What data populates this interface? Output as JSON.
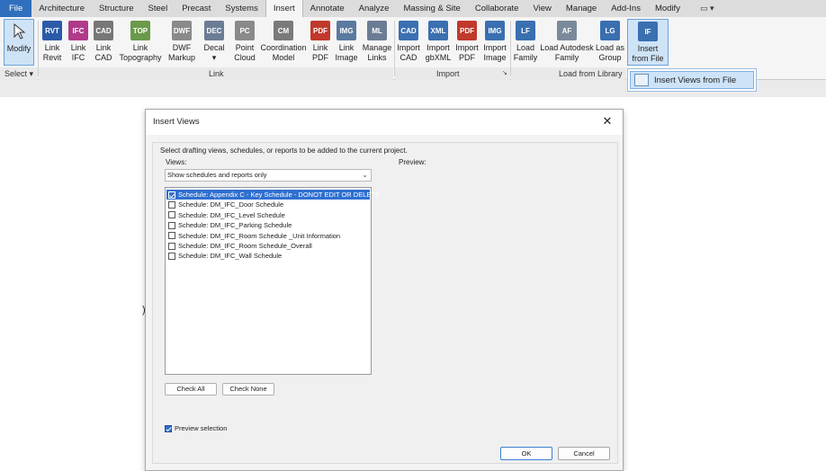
{
  "tabs": {
    "file": "File",
    "items": [
      "Architecture",
      "Structure",
      "Steel",
      "Precast",
      "Systems",
      "Insert",
      "Annotate",
      "Analyze",
      "Massing & Site",
      "Collaborate",
      "View",
      "Manage",
      "Add-Ins",
      "Modify"
    ],
    "active": "Insert",
    "extra": "▭ ▾"
  },
  "ribbon": {
    "modify": {
      "l1": "Modify",
      "l2": ""
    },
    "select": "Select ▾",
    "link_buttons": [
      {
        "l1": "Link",
        "l2": "Revit",
        "icon": "RVT",
        "color": "#2b5aa8"
      },
      {
        "l1": "Link",
        "l2": "IFC",
        "icon": "IFC",
        "color": "#b03a8a"
      },
      {
        "l1": "Link",
        "l2": "CAD",
        "icon": "CAD",
        "color": "#777777"
      },
      {
        "l1": "Link",
        "l2": "Topography",
        "icon": "TOP",
        "color": "#6a9a4a"
      },
      {
        "l1": "DWF",
        "l2": "Markup",
        "icon": "DWF",
        "color": "#8a8a8a"
      },
      {
        "l1": "Decal",
        "l2": "▾",
        "icon": "DEC",
        "color": "#6b7d95"
      },
      {
        "l1": "Point",
        "l2": "Cloud",
        "icon": "PC",
        "color": "#8a8a8a"
      },
      {
        "l1": "Coordination",
        "l2": "Model",
        "icon": "CM",
        "color": "#7a7a7a"
      },
      {
        "l1": "Link",
        "l2": "PDF",
        "icon": "PDF",
        "color": "#c0392b"
      },
      {
        "l1": "Link",
        "l2": "Image",
        "icon": "IMG",
        "color": "#5a7aa0"
      },
      {
        "l1": "Manage",
        "l2": "Links",
        "icon": "ML",
        "color": "#6b7d95"
      }
    ],
    "import_buttons": [
      {
        "l1": "Import",
        "l2": "CAD",
        "icon": "CAD",
        "color": "#3a6fb0"
      },
      {
        "l1": "Import",
        "l2": "gbXML",
        "icon": "XML",
        "color": "#3a6fb0"
      },
      {
        "l1": "Import",
        "l2": "PDF",
        "icon": "PDF",
        "color": "#c0392b"
      },
      {
        "l1": "Import",
        "l2": "Image",
        "icon": "IMG",
        "color": "#3a6fb0"
      }
    ],
    "library_buttons": [
      {
        "l1": "Load",
        "l2": "Family",
        "icon": "LF",
        "color": "#3a6fb0"
      },
      {
        "l1": "Load Autodesk",
        "l2": "Family",
        "icon": "AF",
        "color": "#7a8a9a"
      },
      {
        "l1": "Load as",
        "l2": "Group",
        "icon": "LG",
        "color": "#3a6fb0"
      },
      {
        "l1": "Insert",
        "l2": "from File",
        "icon": "IF",
        "color": "#3a6fb0"
      }
    ],
    "panels": {
      "link": "Link",
      "import": "Import",
      "library": "Load from Library",
      "import_arrow": "↘"
    }
  },
  "dropdown": {
    "item": "Insert Views from File"
  },
  "dialog": {
    "title": "Insert Views",
    "close": "✕",
    "instruction": "Select drafting views, schedules, or reports to be added to the current project.",
    "views_label": "Views:",
    "preview_label": "Preview:",
    "filter_value": "Show schedules and reports only",
    "filter_chevron": "⌄",
    "items": [
      {
        "label": "Schedule: Appendix C - Key Schedule - DONOT EDIT OR DELETE",
        "checked": true,
        "selected": true
      },
      {
        "label": "Schedule: DM_IFC_Door Schedule",
        "checked": false,
        "selected": false
      },
      {
        "label": "Schedule: DM_IFC_Level Schedule",
        "checked": false,
        "selected": false
      },
      {
        "label": "Schedule: DM_IFC_Parking Schedule",
        "checked": false,
        "selected": false
      },
      {
        "label": "Schedule: DM_IFC_Room Schedule _Unit Information",
        "checked": false,
        "selected": false
      },
      {
        "label": "Schedule: DM_IFC_Room Schedule_Overall",
        "checked": false,
        "selected": false
      },
      {
        "label": "Schedule: DM_IFC_Wall Schedule",
        "checked": false,
        "selected": false
      }
    ],
    "check_all": "Check All",
    "check_none": "Check None",
    "preview_selection": "Preview selection",
    "preview_checked": true,
    "ok": "OK",
    "cancel": "Cancel"
  },
  "edge_mark": ")"
}
